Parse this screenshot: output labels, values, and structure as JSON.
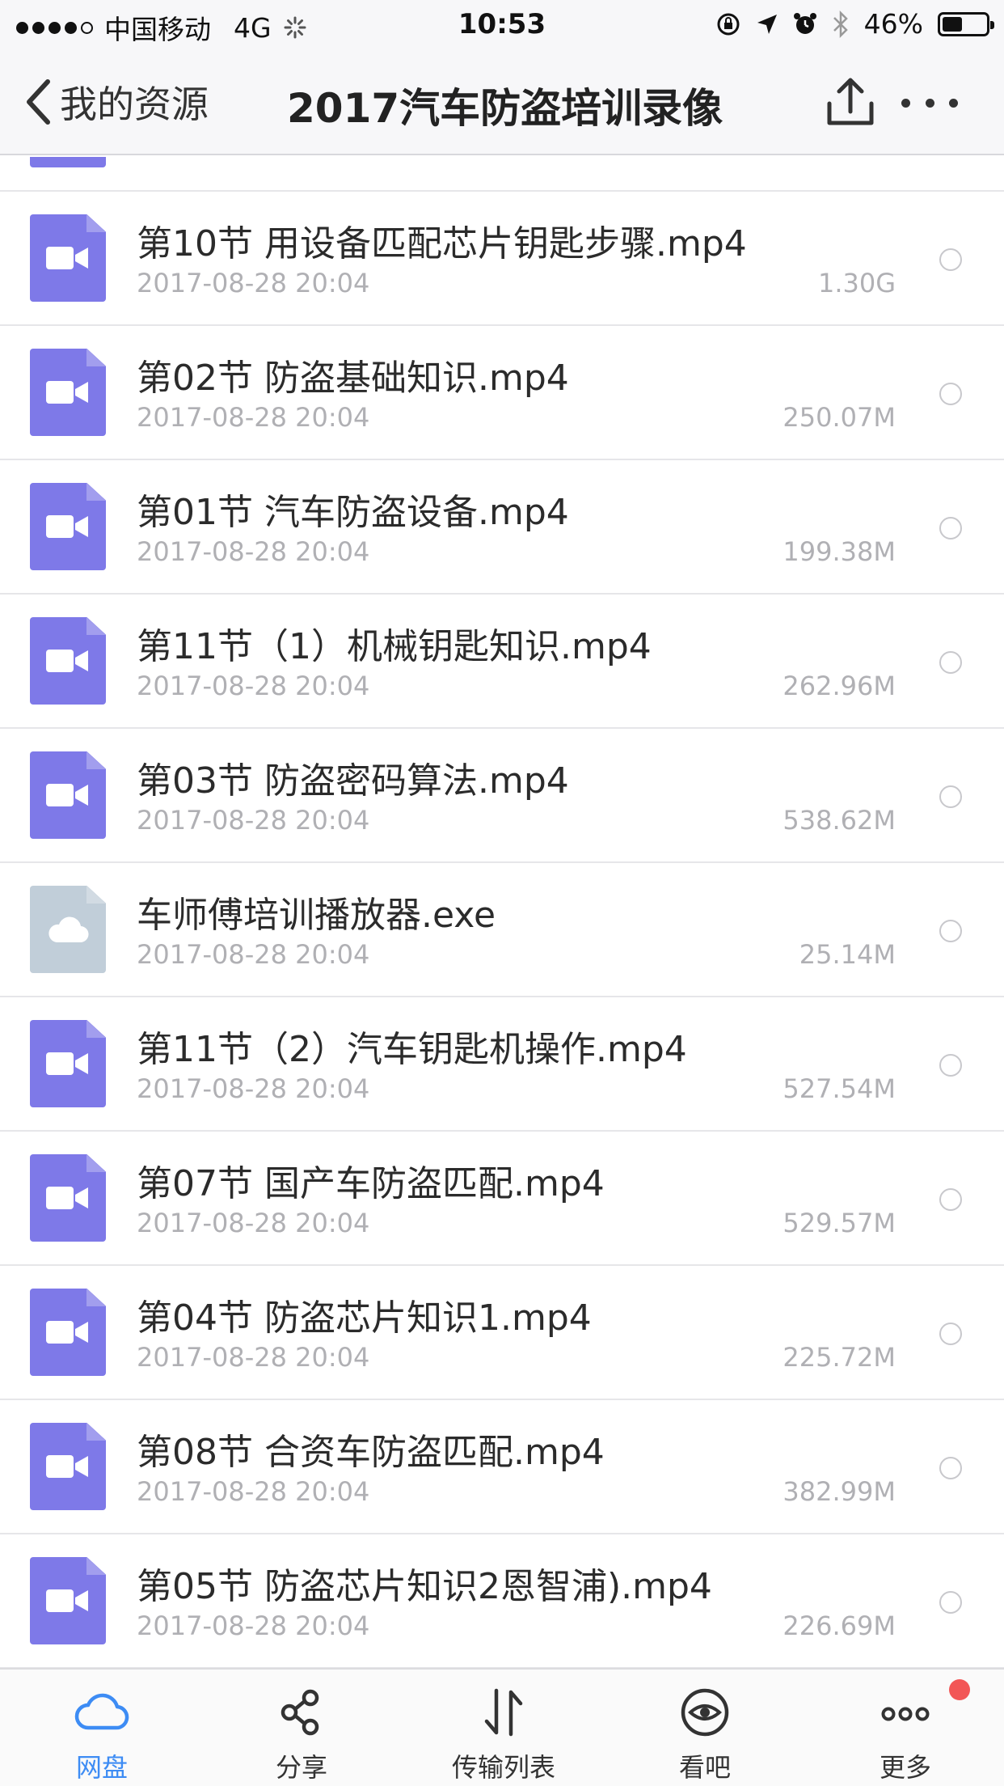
{
  "status_bar": {
    "carrier": "中国移动",
    "network": "4G",
    "time": "10:53",
    "battery": "46%",
    "battery_level": 0.46
  },
  "nav": {
    "back_label": "我的资源",
    "title": "2017汽车防盗培训录像"
  },
  "files": [
    {
      "name": "第10节 用设备匹配芯片钥匙步骤.mp4",
      "date": "2017-08-28 20:04",
      "size": "1.30G",
      "type": "video"
    },
    {
      "name": "第02节 防盗基础知识.mp4",
      "date": "2017-08-28 20:04",
      "size": "250.07M",
      "type": "video"
    },
    {
      "name": "第01节 汽车防盗设备.mp4",
      "date": "2017-08-28 20:04",
      "size": "199.38M",
      "type": "video"
    },
    {
      "name": "第11节（1）机械钥匙知识.mp4",
      "date": "2017-08-28 20:04",
      "size": "262.96M",
      "type": "video"
    },
    {
      "name": "第03节 防盗密码算法.mp4",
      "date": "2017-08-28 20:04",
      "size": "538.62M",
      "type": "video"
    },
    {
      "name": "车师傅培训播放器.exe",
      "date": "2017-08-28 20:04",
      "size": "25.14M",
      "type": "exe"
    },
    {
      "name": "第11节（2）汽车钥匙机操作.mp4",
      "date": "2017-08-28 20:04",
      "size": "527.54M",
      "type": "video"
    },
    {
      "name": "第07节 国产车防盗匹配.mp4",
      "date": "2017-08-28 20:04",
      "size": "529.57M",
      "type": "video"
    },
    {
      "name": "第04节 防盗芯片知识1.mp4",
      "date": "2017-08-28 20:04",
      "size": "225.72M",
      "type": "video"
    },
    {
      "name": "第08节 合资车防盗匹配.mp4",
      "date": "2017-08-28 20:04",
      "size": "382.99M",
      "type": "video"
    },
    {
      "name": "第05节 防盗芯片知识2恩智浦).mp4",
      "date": "2017-08-28 20:04",
      "size": "226.69M",
      "type": "video"
    }
  ],
  "tabs": [
    {
      "label": "网盘",
      "icon": "cloud-icon",
      "active": true
    },
    {
      "label": "分享",
      "icon": "share-icon",
      "active": false
    },
    {
      "label": "传输列表",
      "icon": "transfer-icon",
      "active": false
    },
    {
      "label": "看吧",
      "icon": "eye-icon",
      "active": false
    },
    {
      "label": "更多",
      "icon": "more-dots-icon",
      "active": false
    }
  ],
  "colors": {
    "video_icon": "#7e79e8",
    "exe_icon": "#c1ced9",
    "active_tab": "#3d8cf4",
    "badge": "#f25656"
  }
}
